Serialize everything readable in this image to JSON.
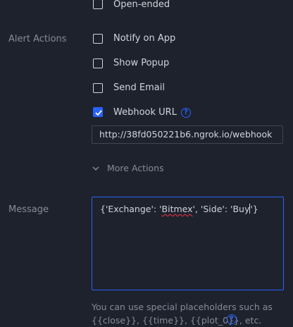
{
  "options": {
    "open_ended_label": "Open-ended"
  },
  "alert_actions": {
    "section_label": "Alert Actions",
    "notify_app": {
      "label": "Notify on App",
      "checked": false
    },
    "show_popup": {
      "label": "Show Popup",
      "checked": false
    },
    "send_email": {
      "label": "Send Email",
      "checked": false
    },
    "webhook": {
      "label": "Webhook URL",
      "checked": true,
      "value": "http://38fd050221b6.ngrok.io/webhook"
    },
    "more_actions_label": "More Actions"
  },
  "message": {
    "section_label": "Message",
    "text_part1": "{'Exchange': '",
    "text_part2": "Bitmex",
    "text_part3": "', 'Side': 'Buy",
    "text_part4": "'}",
    "hint_line1": "You can use special placeholders such as",
    "hint_line2": "{{close}}, {{time}}, {{plot_0}}, etc."
  },
  "colors": {
    "background": "#1e222d",
    "accent": "#2962ff",
    "text": "#d1d4dc",
    "muted": "#868b99"
  }
}
